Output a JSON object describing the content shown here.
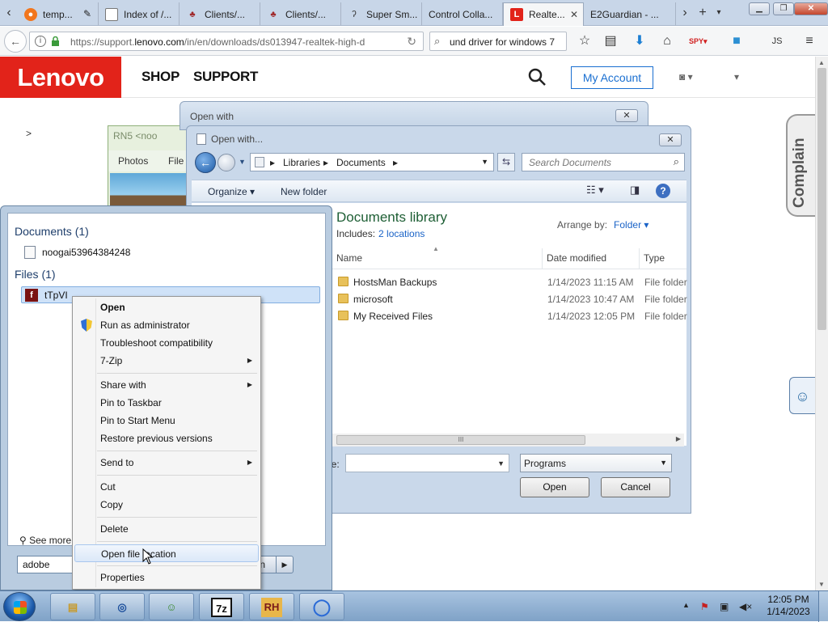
{
  "browser": {
    "tabs": [
      {
        "label": "temp...",
        "icon": "firefox-icon",
        "color": "#f2761d"
      },
      {
        "label": "Index of /...",
        "icon": "document-icon",
        "color": "#777777"
      },
      {
        "label": "Clients/...",
        "icon": "client-icon",
        "color": "#a0282a"
      },
      {
        "label": "Clients/...",
        "icon": "client-icon",
        "color": "#a0282a"
      },
      {
        "label": "Super Sm...",
        "icon": "link-icon",
        "color": "#333333"
      },
      {
        "label": "Control Colla...",
        "icon": "blank-icon",
        "color": "#ffffff"
      },
      {
        "label": "Realte...",
        "icon": "lenovo-l-icon",
        "color": "#e2231a",
        "active": true
      },
      {
        "label": "E2Guardian - ...",
        "icon": "blank-icon",
        "color": "#ffffff"
      }
    ],
    "url_prefix": "https://support.",
    "url_domain": "lenovo.com",
    "url_suffix": "/in/en/downloads/ds013947-realtek-high-d",
    "search_text": "und driver for windows 7"
  },
  "lenovo": {
    "logo": "Lenovo",
    "nav": {
      "shop": "SHOP",
      "support": "SUPPORT"
    },
    "account_label": "My Account",
    "breadcrumb_chevron": ">",
    "complain_label": "Complain",
    "smiley": "☺",
    "brand_color": "#e2231a",
    "link_color": "#1a6fd1"
  },
  "rn5": {
    "title": "RN5 <noo",
    "menu_photos": "Photos",
    "menu_file": "File"
  },
  "open_with_outer": {
    "title": "Open with"
  },
  "file_dialog": {
    "title": "Open with...",
    "breadcrumb": [
      "Libraries",
      "Documents"
    ],
    "search_placeholder": "Search Documents",
    "organize_label": "Organize",
    "new_folder_label": "New folder",
    "library_title": "Documents library",
    "includes_label": "Includes:",
    "includes_link": "2 locations",
    "arrange_label": "Arrange by:",
    "arrange_value": "Folder",
    "columns": {
      "name": "Name",
      "date": "Date modified",
      "type": "Type"
    },
    "files": [
      {
        "name": "HostsMan Backups",
        "date": "1/14/2023 11:15 AM",
        "type": "File folder"
      },
      {
        "name": "microsoft",
        "date": "1/14/2023 10:47 AM",
        "type": "File folder"
      },
      {
        "name": "My Received Files",
        "date": "1/14/2023 12:05 PM",
        "type": "File folder"
      }
    ],
    "filename_label": "ne:",
    "filename_value": "",
    "filetype_value": "Programs",
    "open_label": "Open",
    "cancel_label": "Cancel"
  },
  "start_menu": {
    "documents_group": "Documents (1)",
    "document_item": "noogai53964384248",
    "files_group": "Files (1)",
    "file_item": "tTpVI",
    "see_more": "See more r",
    "search_value": "adobe",
    "shutdown_label": "n"
  },
  "context_menu": {
    "items": [
      {
        "label": "Open",
        "bold": true
      },
      {
        "label": "Run as administrator",
        "icon": "uac-shield-icon"
      },
      {
        "label": "Troubleshoot compatibility"
      },
      {
        "label": "7-Zip",
        "submenu": true
      },
      {
        "label": "Share with",
        "submenu": true
      },
      {
        "label": "Pin to Taskbar"
      },
      {
        "label": "Pin to Start Menu"
      },
      {
        "label": "Restore previous versions"
      },
      {
        "label": "Send to",
        "submenu": true
      },
      {
        "label": "Cut"
      },
      {
        "label": "Copy"
      },
      {
        "label": "Delete"
      },
      {
        "label": "Open file location",
        "hover": true
      },
      {
        "label": "Properties"
      }
    ]
  },
  "taskbar": {
    "apps": [
      {
        "name": "explorer",
        "glyph": "▤"
      },
      {
        "name": "network-tool",
        "glyph": "◎"
      },
      {
        "name": "users-tool",
        "glyph": "☺"
      },
      {
        "name": "7zip",
        "glyph": "7z"
      },
      {
        "name": "rh",
        "glyph": "RH"
      },
      {
        "name": "chrome",
        "glyph": "◯"
      }
    ],
    "clock_time": "12:05 PM",
    "clock_date": "1/14/2023"
  }
}
